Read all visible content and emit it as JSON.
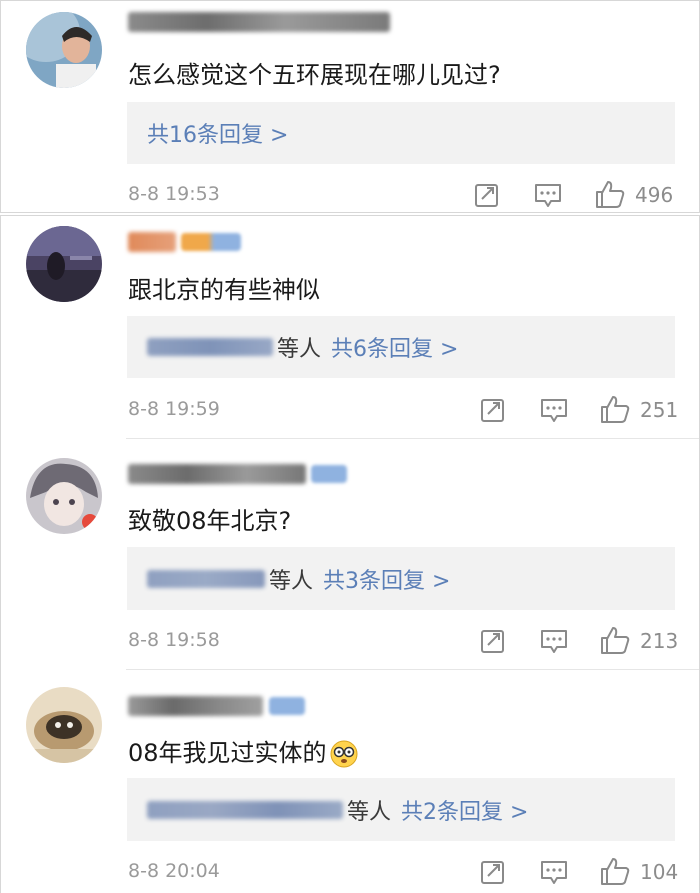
{
  "comments": [
    {
      "text": "怎么感觉这个五环展现在哪儿见过?",
      "reply_prefix": "",
      "reply_count": "共16条回复 >",
      "time": "8-8 19:53",
      "likes": "496"
    },
    {
      "text": "跟北京的有些神似",
      "reply_prefix": "等人",
      "reply_count": "共6条回复 >",
      "time": "8-8 19:59",
      "likes": "251"
    },
    {
      "text": "致敬08年北京?",
      "reply_prefix": "等人",
      "reply_count": "共3条回复 >",
      "time": "8-8 19:58",
      "likes": "213"
    },
    {
      "text": "08年我见过实体的",
      "reply_prefix": "等人",
      "reply_count": "共2条回复 >",
      "time": "8-8 20:04",
      "likes": "104"
    }
  ],
  "colors": {
    "accent": "#5b7fb7",
    "muted": "#9a9a9a",
    "reply_bg": "#f2f2f2",
    "icon": "#8a8a8a"
  },
  "icons": {
    "share": "share-icon",
    "comment": "comment-icon",
    "like": "thumbs-up-icon",
    "emoji": "emoji-icon"
  }
}
